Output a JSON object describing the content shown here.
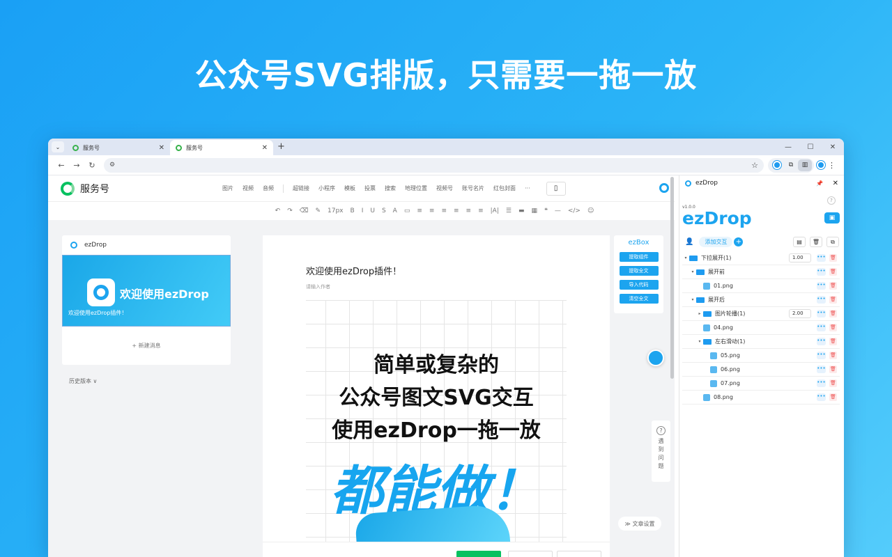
{
  "headline": "公众号SVG排版，只需要一拖一放",
  "browser": {
    "tabs": [
      {
        "title": "服务号",
        "active": false
      },
      {
        "title": "服务号",
        "active": true
      }
    ],
    "new_tab": "+",
    "window_controls": [
      "—",
      "☐",
      "✕"
    ]
  },
  "mp": {
    "logo_text": "服务号",
    "menu": [
      "图片",
      "视频",
      "音频",
      "超链接",
      "小程序",
      "模板",
      "投票",
      "搜索",
      "地理位置",
      "视频号",
      "账号名片",
      "红包封面",
      "···"
    ],
    "toolbar": [
      "↶",
      "↷",
      "⌫",
      "✎",
      "17px",
      "B",
      "I",
      "U",
      "S",
      "A",
      "▭",
      "≡",
      "≡",
      "≡",
      "≡",
      "≡",
      "≡",
      "|A|",
      "☰",
      "▬",
      "▦",
      "❝",
      "—",
      "</>",
      "☺"
    ],
    "left_card": {
      "brand": "ezDrop",
      "cover_title": "欢迎使用ezDrop",
      "cover_caption": "欢迎使用ezDrop插件！",
      "new_message": "+ 新建消息"
    },
    "history": "历史版本 ∨",
    "editor": {
      "title": "欢迎使用ezDrop插件！",
      "author_placeholder": "请输入作者",
      "promo_line1": "简单或复杂的",
      "promo_line2": "公众号图文SVG交互",
      "promo_line3": "使用ezDrop一拖一放",
      "promo_big": "都能做！"
    },
    "ezbox": {
      "title": "ezBox",
      "buttons": [
        "提取组件",
        "提取全文",
        "导入代码",
        "清空全文"
      ]
    },
    "help": [
      "遇",
      "到",
      "问",
      "题"
    ],
    "article_settings": "≫ 文章设置"
  },
  "side_panel": {
    "title": "ezDrop",
    "version": "v1.0.0",
    "brand": "ezDrop",
    "add_interaction": "添加交互",
    "tree": [
      {
        "level": 0,
        "type": "folder",
        "arrow": "▾",
        "label": "下拉展开(1)",
        "value": "1.00"
      },
      {
        "level": 1,
        "type": "folder",
        "arrow": "▾",
        "label": "展开前"
      },
      {
        "level": 2,
        "type": "image",
        "label": "01.png"
      },
      {
        "level": 1,
        "type": "folder",
        "arrow": "▾",
        "label": "展开后"
      },
      {
        "level": 2,
        "type": "folder",
        "arrow": "▸",
        "label": "图片轮播(1)",
        "value": "2.00"
      },
      {
        "level": 2,
        "type": "image",
        "label": "04.png"
      },
      {
        "level": 2,
        "type": "folder",
        "arrow": "▾",
        "label": "左右滑动(1)"
      },
      {
        "level": 3,
        "type": "image",
        "label": "05.png"
      },
      {
        "level": 3,
        "type": "image",
        "label": "06.png"
      },
      {
        "level": 3,
        "type": "image",
        "label": "07.png"
      },
      {
        "level": 2,
        "type": "image",
        "label": "08.png"
      }
    ]
  }
}
